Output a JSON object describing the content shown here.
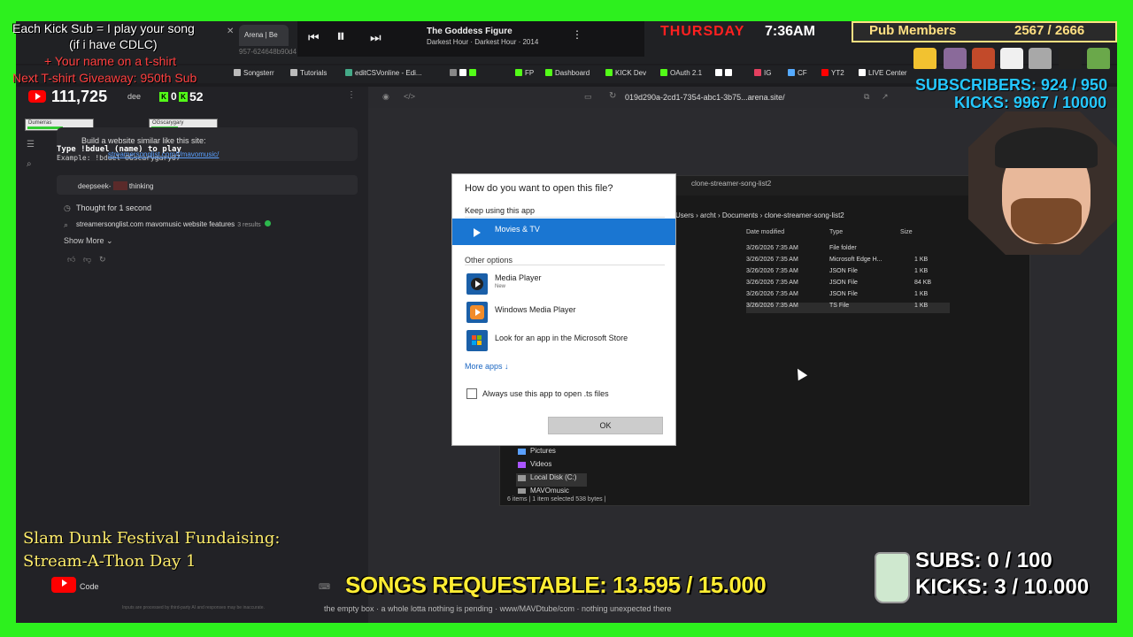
{
  "overlay": {
    "kick_sub_line1": "Each Kick Sub = I play your song",
    "kick_sub_line2": "(if i have CDLC)",
    "tshirt_line": "+ Your name on a t-shirt",
    "giveaway_line": "Next T-shirt Giveaway: 950th Sub",
    "day": "THURSDAY",
    "time": "7:36AM",
    "pub_label": "Pub Members",
    "pub_count": "2567 / 2666",
    "subscribers": "SUBSCRIBERS: 924 / 950",
    "kicks_top": "KICKS: 9967 / 10000",
    "fundraiser_line1": "Slam Dunk Festival Fundaising:",
    "fundraiser_line2": "Stream-A-Thon Day 1",
    "songs_requestable": "SONGS REQUESTABLE: 13.595 / 15.000",
    "subs_bottom": "SUBS: 0 / 100",
    "kicks_bottom": "KICKS: 3 / 10.000",
    "ticker": "the empty box · a whole lotta nothing is pending · www/MAVDtube/com · nothing unexpected there",
    "colors": {
      "green_screen": "#2df01e",
      "yellow": "#ffed33",
      "cyan": "#25c8ff",
      "red": "#ff2020"
    }
  },
  "player": {
    "title": "The Goddess Figure",
    "subtitle": "Darkest Hour · Darkest Hour · 2014",
    "prev_icon": "skip-previous-icon",
    "pause_icon": "pause-icon",
    "next_icon": "skip-next-icon"
  },
  "browser": {
    "tab_label": "Arena | Be",
    "url_fragment": "957-624648b90d4",
    "address": "019d290a-2cd1-7354-abc1-3b75...arena.site/",
    "bookmarks": [
      "Songsterr",
      "Tutorials",
      "editCSVonline - Edi...",
      "FP",
      "Dashboard",
      "KICK Dev",
      "OAuth 2.1",
      "IG",
      "CF",
      "YT2",
      "LIVE Center"
    ]
  },
  "chat": {
    "yt_count": "111,725",
    "twitch_stat": "dee",
    "kick_stat": "0",
    "kick_count": "52",
    "nameplate1": "Dumerras",
    "nameplate2": "OGscarygary",
    "build_prompt": "Build a website similar like this site:",
    "type_cmd": "Type !bduel (name) to play",
    "example_cmd": "Example: !bduel OGscarygary07",
    "link": "streamersonglist.com/t/mavomusic/",
    "assistant_label": "deepseek-",
    "thinking": "thinking",
    "thought": "Thought for 1 second",
    "search_query": "streamersonglist.com mavomusic website features",
    "search_results": "3 results",
    "show_more": "Show More",
    "code_label": "Code",
    "disclaimer": "Inputs are processed by third-party AI and responses may be inaccurate."
  },
  "explorer": {
    "title": "clone-streamer-song-list2",
    "path": [
      "Users",
      "archt",
      "Documents",
      "clone-streamer-song-list2"
    ],
    "columns": [
      "Date modified",
      "Type",
      "Size"
    ],
    "rows": [
      {
        "date": "3/26/2026 7:35 AM",
        "type": "File folder",
        "size": ""
      },
      {
        "date": "3/26/2026 7:35 AM",
        "type": "Microsoft Edge H...",
        "size": "1 KB"
      },
      {
        "date": "3/26/2026 7:35 AM",
        "type": "JSON File",
        "size": "1 KB"
      },
      {
        "date": "3/26/2026 7:35 AM",
        "type": "JSON File",
        "size": "84 KB"
      },
      {
        "date": "3/26/2026 7:35 AM",
        "type": "JSON File",
        "size": "1 KB"
      },
      {
        "date": "3/26/2026 7:35 AM",
        "type": "TS File",
        "size": "1 KB"
      }
    ],
    "nav": [
      "Pictures",
      "Videos",
      "Local Disk (C:)",
      "MAVOmusic"
    ],
    "status": "6 items | 1 item selected 538 bytes |"
  },
  "dialog": {
    "question": "How do you want to open this file?",
    "keep_using": "Keep using this app",
    "selected_app": "Movies & TV",
    "other_options": "Other options",
    "apps": [
      {
        "name": "Media Player",
        "tag": "New"
      },
      {
        "name": "Windows Media Player",
        "tag": ""
      },
      {
        "name": "Look for an app in the Microsoft Store",
        "tag": ""
      }
    ],
    "more_apps": "More apps",
    "always_use": "Always use this app to open .ts files",
    "ok": "OK"
  }
}
